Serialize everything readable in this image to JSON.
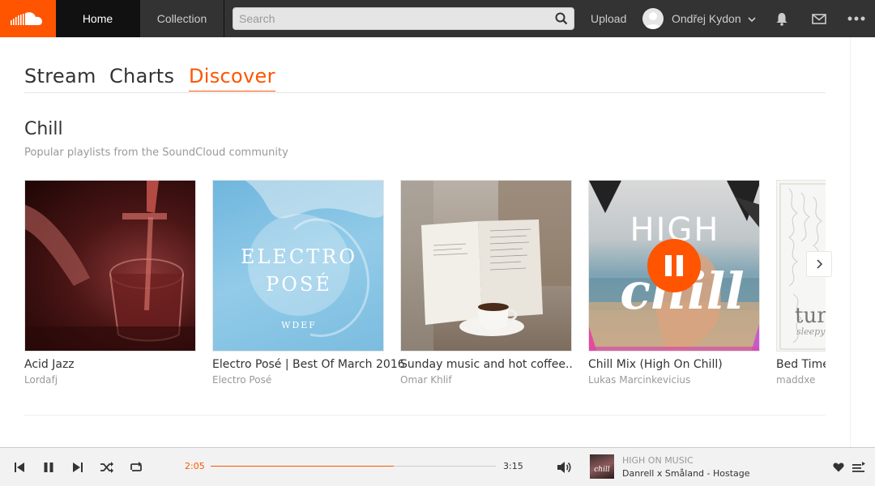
{
  "header": {
    "nav": [
      {
        "label": "Home"
      },
      {
        "label": "Collection"
      }
    ],
    "search_placeholder": "Search",
    "upload_label": "Upload",
    "user_name": "Ondřej Kydon",
    "brand_color": "#ff5500"
  },
  "page_tabs": [
    {
      "label": "Stream"
    },
    {
      "label": "Charts"
    },
    {
      "label": "Discover",
      "active": true
    }
  ],
  "section": {
    "title": "Chill",
    "subtitle": "Popular playlists from the SoundCloud community"
  },
  "playlists": [
    {
      "title": "Acid Jazz",
      "user": "Lordafj"
    },
    {
      "title": "Electro Posé | Best Of March 2016",
      "user": "Electro Posé",
      "art_text_1": "ELECTRO",
      "art_text_2": "POSÉ",
      "art_text_3": "WDEF"
    },
    {
      "title": "Sunday music and hot coffee..",
      "user": "Omar Khlif"
    },
    {
      "title": "Chill Mix (High On Chill)",
      "user": "Lukas Marcinkevicius",
      "art_text_1": "HIGH",
      "art_text_2": "chill",
      "playing": true
    },
    {
      "title": "Bed Time",
      "user": "maddxe",
      "art_text_1": "tur",
      "art_text_2": "sleepy"
    }
  ],
  "player": {
    "elapsed": "2:05",
    "total": "3:15",
    "progress_fraction": 0.641,
    "artist": "HIGH ON MUSIC",
    "track": "Danrell x Småland - Hostage",
    "art_text": "chill"
  }
}
